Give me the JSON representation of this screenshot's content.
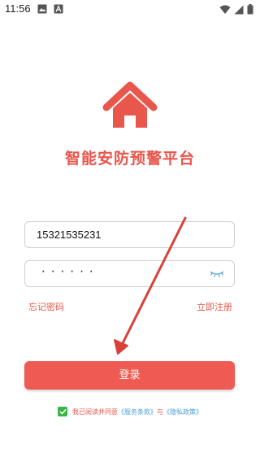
{
  "status_bar": {
    "time": "11:56",
    "left_icons": [
      "image-icon",
      "font-icon"
    ],
    "right_icons": [
      "wifi-icon",
      "signal-icon",
      "battery-icon"
    ]
  },
  "app": {
    "logo_icon": "house-icon",
    "title": "智能安防预警平台",
    "accent_color": "#ef5b52"
  },
  "form": {
    "phone_value": "15321535231",
    "password_masked": "······",
    "password_visibility_icon": "eye-closed-icon"
  },
  "links": {
    "forgot_password": "忘记密码",
    "register": "立即注册"
  },
  "login_button": {
    "label": "登录"
  },
  "agreement": {
    "checked": true,
    "prefix": "我已阅读并同意",
    "terms": "《服务条款》",
    "connector": "与",
    "privacy": "《隐私政策》"
  },
  "annotation": {
    "type": "arrow",
    "color": "#d9403a"
  }
}
